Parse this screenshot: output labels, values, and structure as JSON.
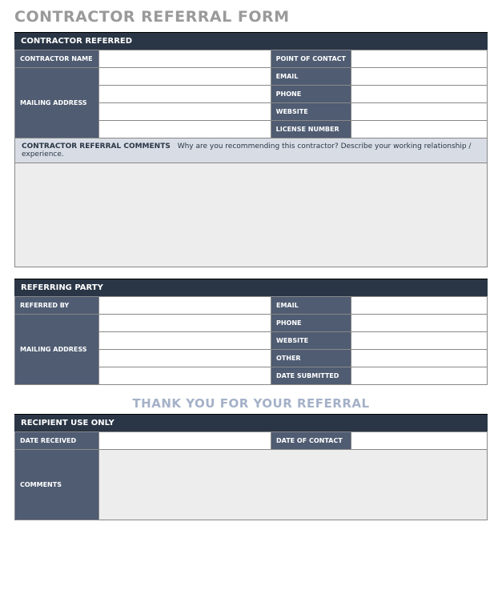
{
  "title": "CONTRACTOR REFERRAL FORM",
  "sections": {
    "contractor": {
      "header": "CONTRACTOR REFERRED",
      "fields": {
        "name": "CONTRACTOR NAME",
        "mailing": "MAILING ADDRESS",
        "poc": "POINT OF CONTACT",
        "email": "EMAIL",
        "phone": "PHONE",
        "website": "WEBSITE",
        "license": "LICENSE NUMBER"
      },
      "values": {
        "name": "",
        "mailing1": "",
        "mailing2": "",
        "mailing3": "",
        "mailing4": "",
        "poc": "",
        "email": "",
        "phone": "",
        "website": "",
        "license": ""
      },
      "comments_label": "CONTRACTOR REFERRAL COMMENTS",
      "comments_hint": "Why are you recommending this contractor? Describe your working relationship / experience.",
      "comments_value": ""
    },
    "referring": {
      "header": "REFERRING PARTY",
      "fields": {
        "referred_by": "REFERRED BY",
        "mailing": "MAILING ADDRESS",
        "email": "EMAIL",
        "phone": "PHONE",
        "website": "WEBSITE",
        "other": "OTHER",
        "date_submitted": "DATE SUBMITTED"
      },
      "values": {
        "referred_by": "",
        "mailing1": "",
        "mailing2": "",
        "mailing3": "",
        "mailing4": "",
        "email": "",
        "phone": "",
        "website": "",
        "other": "",
        "date_submitted": ""
      }
    },
    "thankyou": "THANK YOU FOR YOUR REFERRAL",
    "recipient": {
      "header": "RECIPIENT USE ONLY",
      "fields": {
        "date_received": "DATE RECEIVED",
        "date_contact": "DATE OF CONTACT",
        "comments": "COMMENTS"
      },
      "values": {
        "date_received": "",
        "date_contact": "",
        "comments": ""
      }
    }
  }
}
